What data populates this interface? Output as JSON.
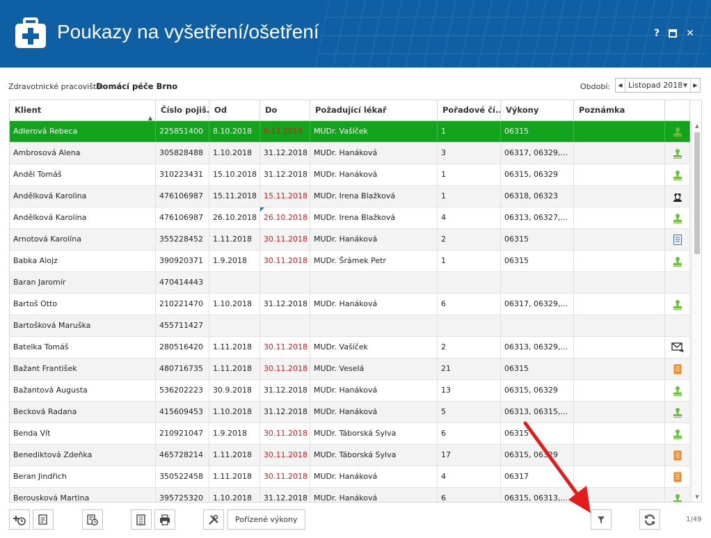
{
  "window": {
    "title": "Poukazy na vyšetření/ošetření",
    "help_label": "?",
    "close_label": "✕"
  },
  "workplace": {
    "label": "Zdravotnické pracoviště:",
    "value": "Domácí péče Brno"
  },
  "period": {
    "label": "Období:",
    "value": "Listopad 2018"
  },
  "grid": {
    "columns": [
      "Klient",
      "Číslo pojiš...",
      "Od",
      "Do",
      "Požadující lékař",
      "Pořadové čí...",
      "Výkony",
      "Poznámka",
      ""
    ],
    "sorted_column": "Klient",
    "rows": [
      {
        "client": "Adlerová Rebeca",
        "ins": "225851400",
        "from": "8.10.2018",
        "to": "8.11.2018",
        "to_red": true,
        "doctor": "MUDr. Vašíček",
        "order": "1",
        "perf": "06315",
        "note": "",
        "icon": "user-stamp-icon",
        "selected": true
      },
      {
        "client": "Ambrosová Alena",
        "ins": "305828488",
        "from": "1.10.2018",
        "to": "31.12.2018",
        "to_red": false,
        "doctor": "MUDr. Hanáková",
        "order": "3",
        "perf": "06317, 06329,...",
        "note": "",
        "icon": "user-stamp-icon"
      },
      {
        "client": "Anděl Tomáš",
        "ins": "310223431",
        "from": "15.10.2018",
        "to": "31.12.2018",
        "to_red": false,
        "doctor": "MUDr. Hanáková",
        "order": "1",
        "perf": "06315, 06329",
        "note": "",
        "icon": "user-stamp-icon"
      },
      {
        "client": "Andělková Karolina",
        "ins": "476106987",
        "from": "15.11.2018",
        "to": "15.11.2018",
        "to_red": true,
        "doctor": "MUDr. Irena Blažková",
        "order": "1",
        "perf": "06318, 06323",
        "note": "",
        "icon": "nurse-icon"
      },
      {
        "client": "Andělková Karolina",
        "ins": "476106987",
        "from": "26.10.2018",
        "to": "26.10.2018",
        "to_red": true,
        "doctor": "MUDr. Irena Blažková",
        "order": "4",
        "perf": "06313, 06327,...",
        "note": "",
        "icon": "user-stamp-icon",
        "marker": true
      },
      {
        "client": "Arnotová Karolína",
        "ins": "355228452",
        "from": "1.11.2018",
        "to": "30.11.2018",
        "to_red": true,
        "doctor": "MUDr. Hanáková",
        "order": "2",
        "perf": "06315",
        "note": "",
        "icon": "document-blue-icon"
      },
      {
        "client": "Babka Alojz",
        "ins": "390920371",
        "from": "1.9.2018",
        "to": "30.11.2018",
        "to_red": true,
        "doctor": "MUDr. Šrámek Petr",
        "order": "1",
        "perf": "06315",
        "note": "",
        "icon": "user-stamp-icon"
      },
      {
        "client": "Baran Jaromír",
        "ins": "470414443",
        "from": "",
        "to": "",
        "to_red": false,
        "doctor": "",
        "order": "",
        "perf": "",
        "note": "",
        "icon": ""
      },
      {
        "client": "Bartoš Otto",
        "ins": "210221470",
        "from": "1.10.2018",
        "to": "31.12.2018",
        "to_red": false,
        "doctor": "MUDr. Hanáková",
        "order": "6",
        "perf": "06317, 06329,...",
        "note": "",
        "icon": "user-stamp-icon"
      },
      {
        "client": "Bartošková Maruška",
        "ins": "455711427",
        "from": "",
        "to": "",
        "to_red": false,
        "doctor": "",
        "order": "",
        "perf": "",
        "note": "",
        "icon": ""
      },
      {
        "client": "Batelka Tomáš",
        "ins": "280516420",
        "from": "1.11.2018",
        "to": "30.11.2018",
        "to_red": true,
        "doctor": "MUDr. Vašíček",
        "order": "2",
        "perf": "06313, 06329,...",
        "note": "",
        "icon": "envelope-icon"
      },
      {
        "client": "Bažant František",
        "ins": "480716735",
        "from": "1.11.2018",
        "to": "30.11.2018",
        "to_red": true,
        "doctor": "MUDr. Veselá",
        "order": "21",
        "perf": "06315",
        "note": "",
        "icon": "document-orange-icon"
      },
      {
        "client": "Bažantová Augusta",
        "ins": "536202223",
        "from": "30.9.2018",
        "to": "31.12.2018",
        "to_red": false,
        "doctor": "MUDr. Hanáková",
        "order": "13",
        "perf": "06315, 06329",
        "note": "",
        "icon": "user-stamp-icon"
      },
      {
        "client": "Becková Radana",
        "ins": "415609453",
        "from": "1.10.2018",
        "to": "31.12.2018",
        "to_red": false,
        "doctor": "MUDr. Hanáková",
        "order": "5",
        "perf": "06313, 06315,...",
        "note": "",
        "icon": "user-stamp-icon"
      },
      {
        "client": "Benda Vít",
        "ins": "210921047",
        "from": "1.9.2018",
        "to": "30.11.2018",
        "to_red": true,
        "doctor": "MUDr. Táborská Sylva",
        "order": "6",
        "perf": "06315",
        "note": "",
        "icon": "user-stamp-icon"
      },
      {
        "client": "Benediktová Zdeňka",
        "ins": "465728214",
        "from": "1.11.2018",
        "to": "30.11.2018",
        "to_red": true,
        "doctor": "MUDr. Táborská Sylva",
        "order": "17",
        "perf": "06315, 06329",
        "note": "",
        "icon": "document-orange-icon"
      },
      {
        "client": "Beran Jindřich",
        "ins": "350522458",
        "from": "1.11.2018",
        "to": "30.11.2018",
        "to_red": true,
        "doctor": "MUDr. Hanáková",
        "order": "4",
        "perf": "06317",
        "note": "",
        "icon": "document-orange-icon"
      },
      {
        "client": "Berousková Martina",
        "ins": "395725320",
        "from": "1.10.2018",
        "to": "31.12.2018",
        "to_red": false,
        "doctor": "MUDr. Hanáková",
        "order": "6",
        "perf": "06315, 06313,...",
        "note": "",
        "icon": "user-stamp-icon"
      }
    ]
  },
  "toolbar": {
    "performed_label": "Pořízené výkony",
    "pager": "1/49"
  },
  "colors": {
    "titlebar": "#0e5fa3",
    "selected_row": "#14a31d",
    "red_date": "#e0161b",
    "annotation_arrow": "#e31b1b"
  }
}
